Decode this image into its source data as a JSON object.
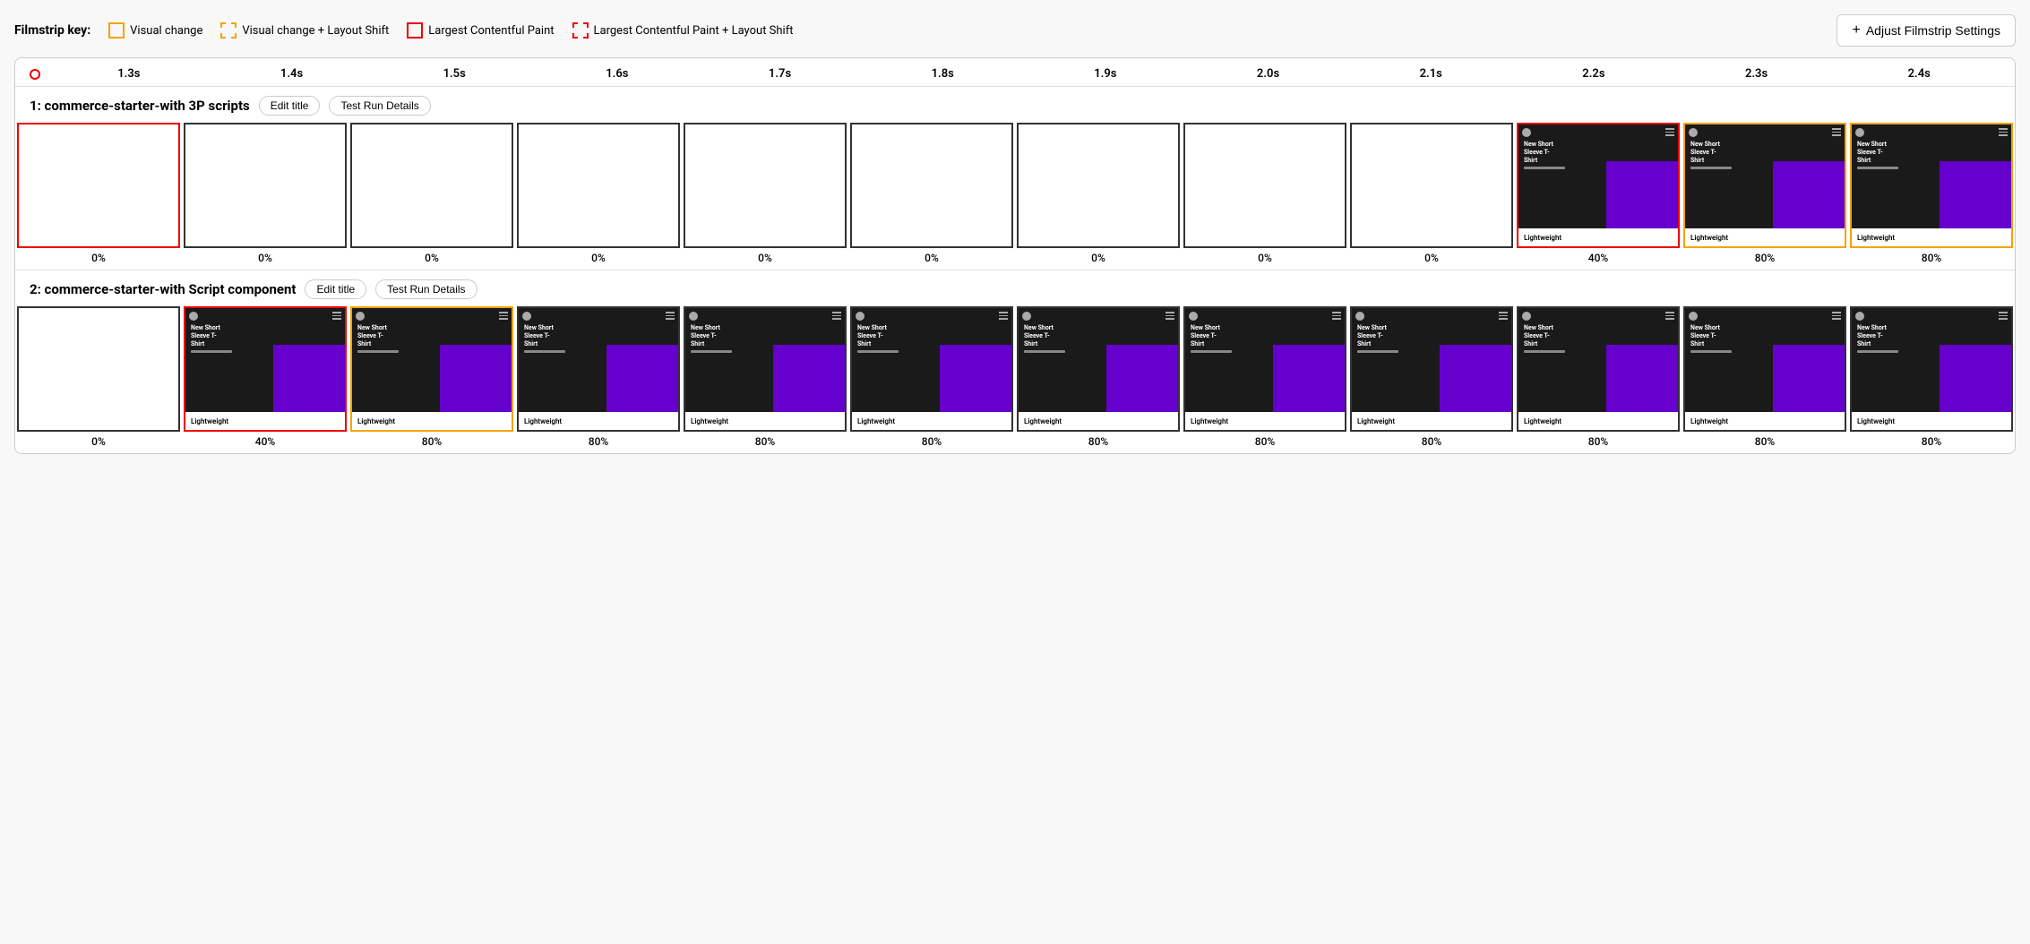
{
  "filmstrip_key": {
    "label": "Filmstrip key:",
    "items": [
      {
        "id": "visual-change",
        "type": "visual-change",
        "label": "Visual change"
      },
      {
        "id": "visual-change-layout",
        "type": "visual-change-layout",
        "label": "Visual change + Layout Shift"
      },
      {
        "id": "lcp",
        "type": "lcp",
        "label": "Largest Contentful Paint"
      },
      {
        "id": "lcp-layout",
        "type": "lcp-layout",
        "label": "Largest Contentful Paint + Layout Shift"
      }
    ]
  },
  "adjust_btn_label": "Adjust Filmstrip Settings",
  "timeline": {
    "ticks": [
      "1.3s",
      "1.4s",
      "1.5s",
      "1.6s",
      "1.7s",
      "1.8s",
      "1.9s",
      "2.0s",
      "2.1s",
      "2.2s",
      "2.3s",
      "2.4s"
    ]
  },
  "rows": [
    {
      "id": "row1",
      "title": "1: commerce-starter-with 3P scripts",
      "edit_label": "Edit title",
      "details_label": "Test Run Details",
      "frames": [
        {
          "border": "red",
          "empty": true,
          "percent": "0%"
        },
        {
          "border": "normal",
          "empty": true,
          "percent": "0%"
        },
        {
          "border": "normal",
          "empty": true,
          "percent": "0%"
        },
        {
          "border": "normal",
          "empty": true,
          "percent": "0%"
        },
        {
          "border": "normal",
          "empty": true,
          "percent": "0%"
        },
        {
          "border": "normal",
          "empty": true,
          "percent": "0%"
        },
        {
          "border": "normal",
          "empty": true,
          "percent": "0%"
        },
        {
          "border": "normal",
          "empty": true,
          "percent": "0%"
        },
        {
          "border": "normal",
          "empty": true,
          "percent": "0%"
        },
        {
          "border": "red",
          "empty": false,
          "percent": "40%"
        },
        {
          "border": "orange",
          "empty": false,
          "percent": "80%"
        },
        {
          "border": "orange",
          "empty": false,
          "percent": "80%"
        }
      ]
    },
    {
      "id": "row2",
      "title": "2: commerce-starter-with Script component",
      "edit_label": "Edit title",
      "details_label": "Test Run Details",
      "frames": [
        {
          "border": "normal",
          "empty": true,
          "percent": "0%"
        },
        {
          "border": "red",
          "empty": false,
          "percent": "40%"
        },
        {
          "border": "orange",
          "empty": false,
          "percent": "80%"
        },
        {
          "border": "normal",
          "empty": false,
          "percent": "80%"
        },
        {
          "border": "normal",
          "empty": false,
          "percent": "80%"
        },
        {
          "border": "normal",
          "empty": false,
          "percent": "80%"
        },
        {
          "border": "normal",
          "empty": false,
          "percent": "80%"
        },
        {
          "border": "normal",
          "empty": false,
          "percent": "80%"
        },
        {
          "border": "normal",
          "empty": false,
          "percent": "80%"
        },
        {
          "border": "normal",
          "empty": false,
          "percent": "80%"
        },
        {
          "border": "normal",
          "empty": false,
          "percent": "80%"
        },
        {
          "border": "normal",
          "empty": false,
          "percent": "80%"
        }
      ]
    }
  ]
}
